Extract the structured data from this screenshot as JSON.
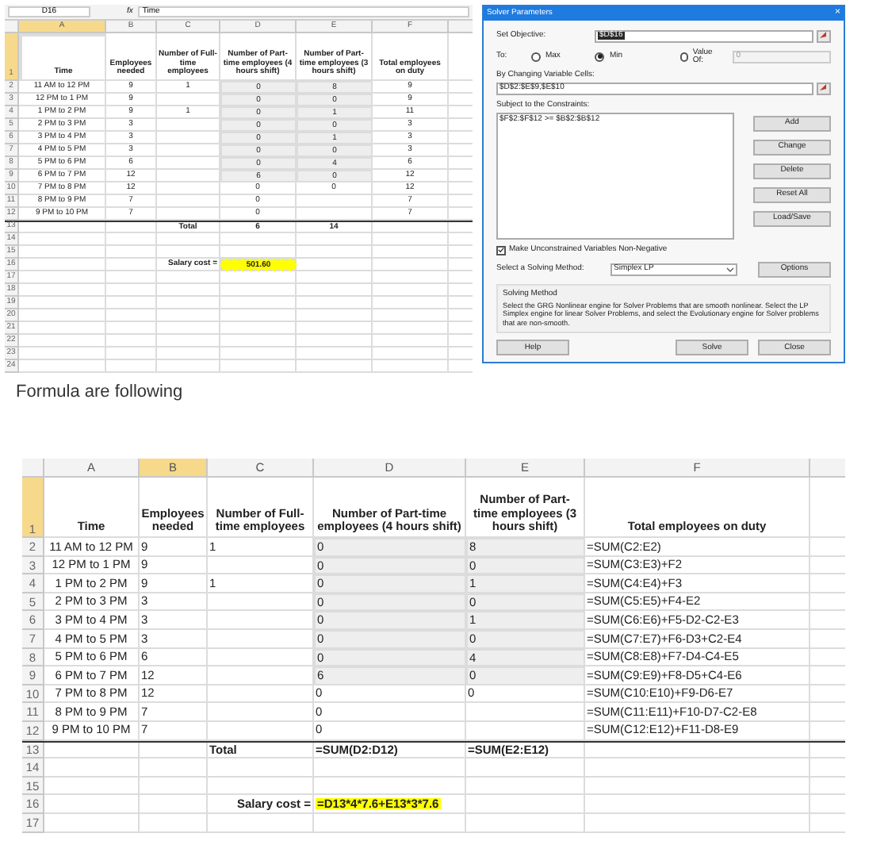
{
  "top_sheet": {
    "kind": "values",
    "name_box": "D16",
    "fx_label": "fx",
    "formula": "Time",
    "columns": [
      {
        "label": "A",
        "selected": true
      },
      {
        "label": "B",
        "selected": false
      },
      {
        "label": "C",
        "selected": false
      },
      {
        "label": "D",
        "selected": false
      },
      {
        "label": "E",
        "selected": false
      },
      {
        "label": "F",
        "selected": false
      }
    ],
    "rows": [
      {
        "number": "1",
        "kind": "header",
        "selected": true,
        "variable": false,
        "cells": {
          "A": "Time",
          "B": "Employees needed",
          "C": "Number of Full-time employees",
          "D": "Number of Part-time employees (4 hours shift)",
          "E": "Number of Part-time employees (3 hours shift)",
          "F": "Total employees on duty"
        }
      },
      {
        "number": "2",
        "kind": "data",
        "selected": false,
        "variable": true,
        "cells": {
          "A": "11 AM to 12 PM",
          "B": "9",
          "C": "1",
          "D": "0",
          "E": "8",
          "F": "9"
        }
      },
      {
        "number": "3",
        "kind": "data",
        "selected": false,
        "variable": true,
        "cells": {
          "A": "12 PM to 1 PM",
          "B": "9",
          "D": "0",
          "E": "0",
          "F": "9"
        }
      },
      {
        "number": "4",
        "kind": "data",
        "selected": false,
        "variable": true,
        "cells": {
          "A": "1 PM to 2 PM",
          "B": "9",
          "C": "1",
          "D": "0",
          "E": "1",
          "F": "11"
        }
      },
      {
        "number": "5",
        "kind": "data",
        "selected": false,
        "variable": true,
        "cells": {
          "A": "2 PM to 3 PM",
          "B": "3",
          "D": "0",
          "E": "0",
          "F": "3"
        }
      },
      {
        "number": "6",
        "kind": "data",
        "selected": false,
        "variable": true,
        "cells": {
          "A": "3 PM to 4 PM",
          "B": "3",
          "D": "0",
          "E": "1",
          "F": "3"
        }
      },
      {
        "number": "7",
        "kind": "data",
        "selected": false,
        "variable": true,
        "cells": {
          "A": "4 PM to 5 PM",
          "B": "3",
          "D": "0",
          "E": "0",
          "F": "3"
        }
      },
      {
        "number": "8",
        "kind": "data",
        "selected": false,
        "variable": true,
        "cells": {
          "A": "5 PM to 6 PM",
          "B": "6",
          "D": "0",
          "E": "4",
          "F": "6"
        }
      },
      {
        "number": "9",
        "kind": "data",
        "selected": false,
        "variable": true,
        "cells": {
          "A": "6 PM to 7 PM",
          "B": "12",
          "D": "6",
          "E": "0",
          "F": "12"
        }
      },
      {
        "number": "10",
        "kind": "data",
        "selected": false,
        "variable": false,
        "cells": {
          "A": "7 PM to 8 PM",
          "B": "12",
          "D": "0",
          "E": "0",
          "F": "12"
        }
      },
      {
        "number": "11",
        "kind": "data",
        "selected": false,
        "variable": false,
        "cells": {
          "A": "8 PM to 9 PM",
          "B": "7",
          "D": "0",
          "F": "7"
        }
      },
      {
        "number": "12",
        "kind": "data",
        "selected": false,
        "variable": false,
        "cells": {
          "A": "9 PM to 10 PM",
          "B": "7",
          "D": "0",
          "F": "7"
        }
      },
      {
        "number": "13",
        "kind": "total",
        "selected": false,
        "variable": false,
        "cells": {
          "C": "Total",
          "D": "6",
          "E": "14"
        }
      },
      {
        "number": "14",
        "kind": "empty",
        "selected": false,
        "variable": false
      },
      {
        "number": "15",
        "kind": "empty",
        "selected": false,
        "variable": false
      },
      {
        "number": "16",
        "kind": "cost",
        "selected": false,
        "variable": false,
        "cells": {
          "C": "Salary cost =",
          "D": "501.60"
        }
      },
      {
        "number": "17",
        "kind": "empty",
        "selected": false,
        "variable": false
      },
      {
        "number": "18",
        "kind": "empty",
        "selected": false,
        "variable": false
      },
      {
        "number": "19",
        "kind": "empty",
        "selected": false,
        "variable": false
      },
      {
        "number": "20",
        "kind": "empty",
        "selected": false,
        "variable": false
      },
      {
        "number": "21",
        "kind": "empty",
        "selected": false,
        "variable": false
      },
      {
        "number": "22",
        "kind": "empty",
        "selected": false,
        "variable": false
      },
      {
        "number": "23",
        "kind": "empty",
        "selected": false,
        "variable": false
      },
      {
        "number": "24",
        "kind": "empty",
        "selected": false,
        "variable": false
      }
    ]
  },
  "solver": {
    "title": "Solver Parameters",
    "close": "×",
    "objective_label": "Set Objective:",
    "objective": "$D$16",
    "to_label": "To:",
    "goals": [
      {
        "label": "Max",
        "selected": false
      },
      {
        "label": "Min",
        "selected": true
      },
      {
        "label": "Value Of:",
        "selected": false
      }
    ],
    "value_of": "0",
    "changing_label": "By Changing Variable Cells:",
    "changing": "$D$2:$E$9,$E$10",
    "constraints_label": "Subject to the Constraints:",
    "constraints": [
      "$F$2:$F$12 >= $B$2:$B$12"
    ],
    "side_buttons": [
      "Add",
      "Change",
      "Delete",
      "Reset All",
      "Load/Save"
    ],
    "nonnegative": {
      "label": "Make Unconstrained Variables Non-Negative",
      "checked": true
    },
    "method_label": "Select a Solving Method:",
    "method": "Simplex LP",
    "options_button": "Options",
    "method_group": {
      "title": "Solving Method",
      "text": "Select the GRG Nonlinear engine for Solver Problems that are smooth nonlinear. Select the LP Simplex engine for linear Solver Problems, and select the Evolutionary engine for Solver problems that are non-smooth."
    },
    "bottom_buttons": [
      "Help",
      "Solve",
      "Close"
    ]
  },
  "caption": "Formula are following",
  "bottom_sheet": {
    "kind": "formulas",
    "columns": [
      {
        "label": "A",
        "selected": false
      },
      {
        "label": "B",
        "selected": true
      },
      {
        "label": "C",
        "selected": false
      },
      {
        "label": "D",
        "selected": false
      },
      {
        "label": "E",
        "selected": false
      },
      {
        "label": "F",
        "selected": false
      }
    ],
    "rows": [
      {
        "number": "1",
        "kind": "header",
        "selected": true,
        "variable": false,
        "cells": {
          "A": "Time",
          "B": "Employees needed",
          "C": "Number of Full-time employees",
          "D": "Number of Part-time employees (4 hours shift)",
          "E": "Number of Part-time employees (3 hours shift)",
          "F": "Total employees on duty"
        }
      },
      {
        "number": "2",
        "kind": "data",
        "selected": false,
        "variable": true,
        "cells": {
          "A": "11 AM to 12 PM",
          "B": "9",
          "C": "1",
          "D": "0",
          "E": "8",
          "F": "=SUM(C2:E2)"
        }
      },
      {
        "number": "3",
        "kind": "data",
        "selected": false,
        "variable": true,
        "cells": {
          "A": "12 PM to 1 PM",
          "B": "9",
          "D": "0",
          "E": "0",
          "F": "=SUM(C3:E3)+F2"
        }
      },
      {
        "number": "4",
        "kind": "data",
        "selected": false,
        "variable": true,
        "cells": {
          "A": "1 PM to 2 PM",
          "B": "9",
          "C": "1",
          "D": "0",
          "E": "1",
          "F": "=SUM(C4:E4)+F3"
        }
      },
      {
        "number": "5",
        "kind": "data",
        "selected": false,
        "variable": true,
        "cells": {
          "A": "2 PM to 3 PM",
          "B": "3",
          "D": "0",
          "E": "0",
          "F": "=SUM(C5:E5)+F4-E2"
        }
      },
      {
        "number": "6",
        "kind": "data",
        "selected": false,
        "variable": true,
        "cells": {
          "A": "3 PM to 4 PM",
          "B": "3",
          "D": "0",
          "E": "1",
          "F": "=SUM(C6:E6)+F5-D2-C2-E3"
        }
      },
      {
        "number": "7",
        "kind": "data",
        "selected": false,
        "variable": true,
        "cells": {
          "A": "4 PM to 5 PM",
          "B": "3",
          "D": "0",
          "E": "0",
          "F": "=SUM(C7:E7)+F6-D3+C2-E4"
        }
      },
      {
        "number": "8",
        "kind": "data",
        "selected": false,
        "variable": true,
        "cells": {
          "A": "5 PM to 6 PM",
          "B": "6",
          "D": "0",
          "E": "4",
          "F": "=SUM(C8:E8)+F7-D4-C4-E5"
        }
      },
      {
        "number": "9",
        "kind": "data",
        "selected": false,
        "variable": true,
        "cells": {
          "A": "6 PM to 7 PM",
          "B": "12",
          "D": "6",
          "E": "0",
          "F": "=SUM(C9:E9)+F8-D5+C4-E6"
        }
      },
      {
        "number": "10",
        "kind": "data",
        "selected": false,
        "variable": false,
        "cells": {
          "A": "7 PM to 8 PM",
          "B": "12",
          "D": "0",
          "E": "0",
          "F": "=SUM(C10:E10)+F9-D6-E7"
        }
      },
      {
        "number": "11",
        "kind": "data",
        "selected": false,
        "variable": false,
        "cells": {
          "A": "8 PM to 9 PM",
          "B": "7",
          "D": "0",
          "F": "=SUM(C11:E11)+F10-D7-C2-E8"
        }
      },
      {
        "number": "12",
        "kind": "data",
        "selected": false,
        "variable": false,
        "cells": {
          "A": "9 PM to 10 PM",
          "B": "7",
          "D": "0",
          "F": "=SUM(C12:E12)+F11-D8-E9"
        }
      },
      {
        "number": "13",
        "kind": "total",
        "selected": false,
        "variable": false,
        "cells": {
          "C": "Total",
          "D": "=SUM(D2:D12)",
          "E": "=SUM(E2:E12)"
        }
      },
      {
        "number": "14",
        "kind": "empty",
        "selected": false,
        "variable": false
      },
      {
        "number": "15",
        "kind": "empty",
        "selected": false,
        "variable": false
      },
      {
        "number": "16",
        "kind": "cost",
        "selected": false,
        "variable": false,
        "cells": {
          "C": "Salary cost =",
          "D": "=D13*4*7.6+E13*3*7.6"
        }
      },
      {
        "number": "17",
        "kind": "empty",
        "selected": false,
        "variable": false
      }
    ]
  }
}
